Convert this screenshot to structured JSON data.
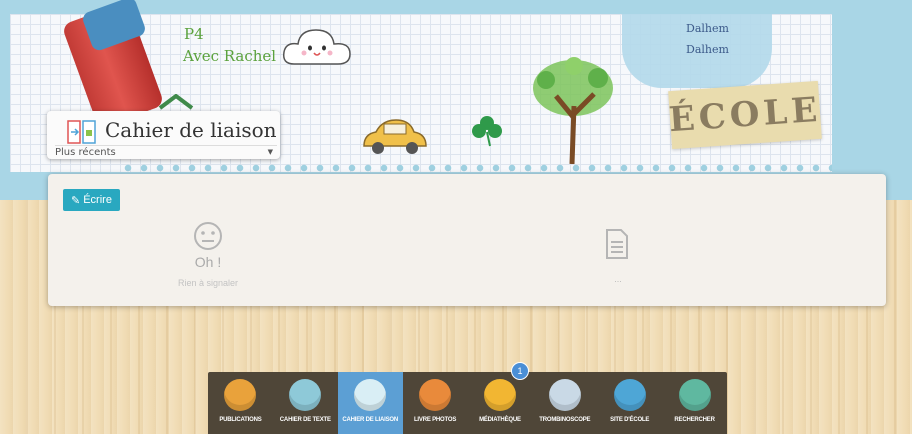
{
  "header": {
    "class_name": "P4",
    "teacher": "Avec Rachel",
    "speech_lines": [
      "Dalhem",
      "Dalhem"
    ],
    "sign_text": "ÉCOLE"
  },
  "title_widget": {
    "title": "Cahier de liaison",
    "filter_selected": "Plus récents"
  },
  "panel": {
    "write_button": "Écrire",
    "empty_title": "Oh !",
    "empty_subtitle": "Rien à signaler",
    "doc_placeholder": "..."
  },
  "nav": {
    "items": [
      {
        "label": "PUBLICATIONS",
        "icon": "publications-icon",
        "color": "#e9a23b"
      },
      {
        "label": "CAHIER DE TEXTE",
        "icon": "textbook-icon",
        "color": "#8ec9d8"
      },
      {
        "label": "CAHIER DE LIAISON",
        "icon": "liaison-notebook-icon",
        "color": "#d9eef5"
      },
      {
        "label": "LIVRE PHOTOS",
        "icon": "photo-book-icon",
        "color": "#e98a3b"
      },
      {
        "label": "MÉDIATHÈQUE",
        "icon": "media-library-icon",
        "color": "#f2b632"
      },
      {
        "label": "TROMBINOSCOPE",
        "icon": "yearbook-icon",
        "color": "#c9d9e6"
      },
      {
        "label": "SITE D'ÉCOLE",
        "icon": "school-site-icon",
        "color": "#4ea6d6"
      },
      {
        "label": "RECHERCHER",
        "icon": "search-icon",
        "color": "#5fb8a0"
      }
    ],
    "active_index": 2,
    "badge_count": "1"
  },
  "colors": {
    "accent": "#29a8c0",
    "nav_bg": "#4f4638",
    "nav_active": "#5c9fd4",
    "class_green": "#5ba23d"
  }
}
